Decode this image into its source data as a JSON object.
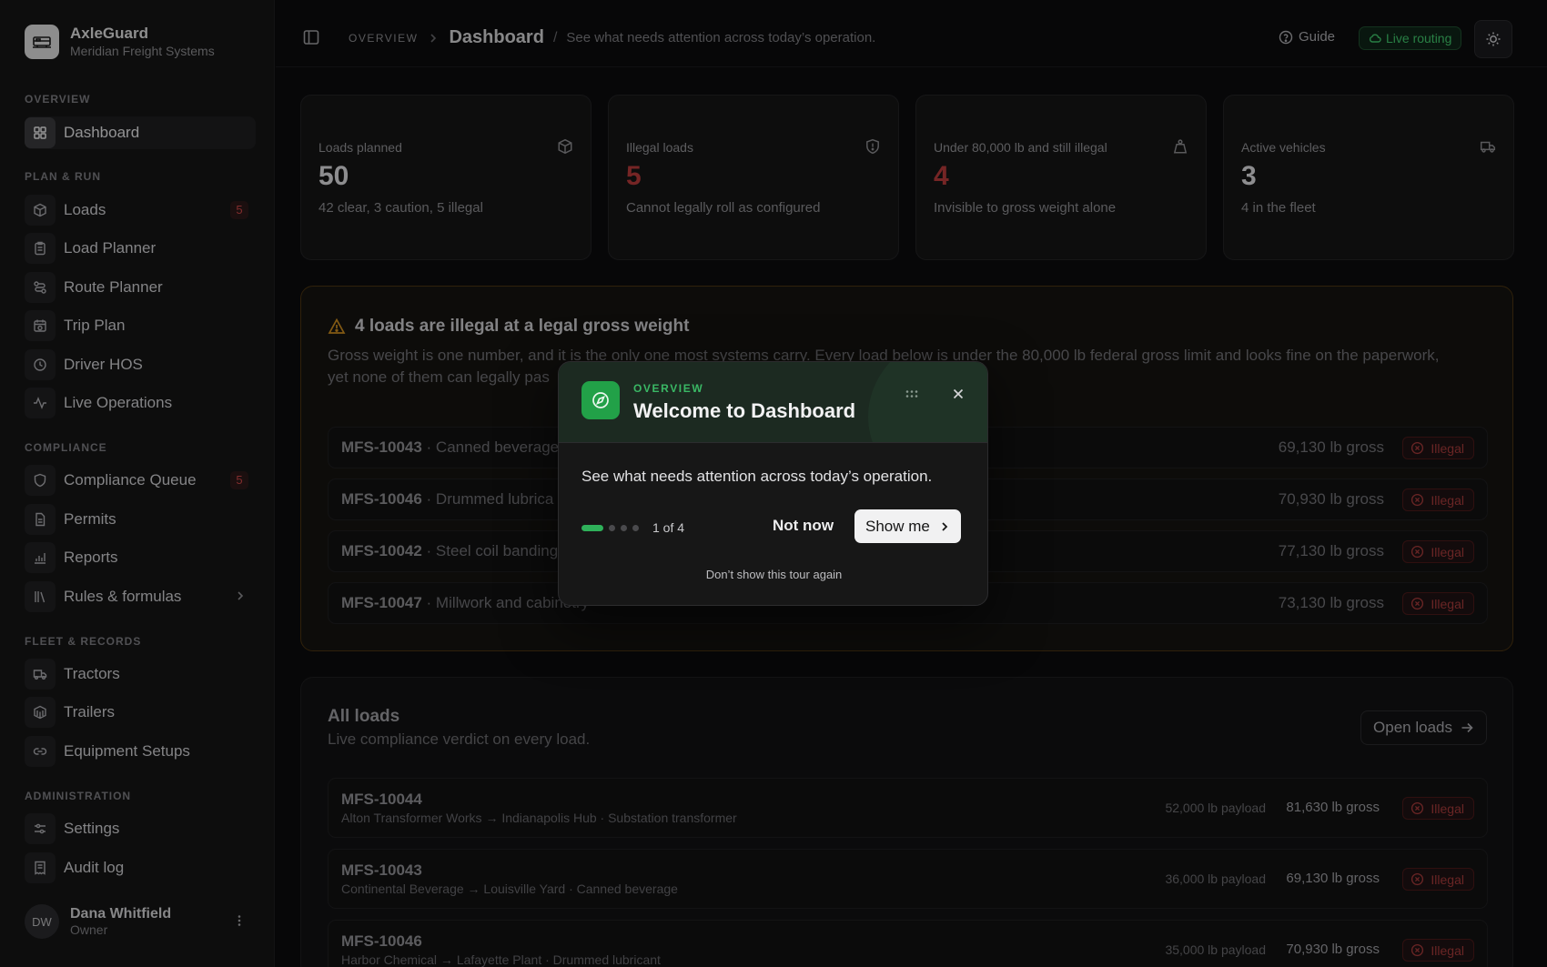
{
  "brand": {
    "name": "AxleGuard",
    "subtitle": "Meridian Freight Systems"
  },
  "sidebar": {
    "sections": {
      "overview": "OVERVIEW",
      "plan_run": "PLAN & RUN",
      "compliance": "COMPLIANCE",
      "fleet": "FLEET & RECORDS",
      "admin": "ADMINISTRATION"
    },
    "items": {
      "dashboard": "Dashboard",
      "loads": "Loads",
      "loads_badge": "5",
      "load_planner": "Load Planner",
      "route_planner": "Route Planner",
      "trip_plan": "Trip Plan",
      "driver_hos": "Driver HOS",
      "live_operations": "Live Operations",
      "compliance_queue": "Compliance Queue",
      "compliance_badge": "5",
      "permits": "Permits",
      "reports": "Reports",
      "rules": "Rules & formulas",
      "tractors": "Tractors",
      "trailers": "Trailers",
      "equipment": "Equipment Setups",
      "settings": "Settings",
      "audit_log": "Audit log"
    },
    "user": {
      "initials": "DW",
      "name": "Dana Whitfield",
      "role": "Owner"
    }
  },
  "topbar": {
    "breadcrumb_root": "OVERVIEW",
    "title": "Dashboard",
    "description": "See what needs attention across today’s operation.",
    "guide": "Guide",
    "live_routing": "Live routing"
  },
  "stats": [
    {
      "label": "Loads planned",
      "value": "50",
      "sub": "42 clear, 3 caution, 5 illegal"
    },
    {
      "label": "Illegal loads",
      "value": "5",
      "sub": "Cannot legally roll as configured"
    },
    {
      "label": "Under 80,000 lb and still illegal",
      "value": "4",
      "sub": "Invisible to gross weight alone"
    },
    {
      "label": "Active vehicles",
      "value": "3",
      "sub": "4 in the fleet"
    }
  ],
  "alert": {
    "title": "4 loads are illegal at a legal gross weight",
    "text_line1": "Gross weight is one number, and it is the only one most systems carry. Every load below is under the 80,000 lb federal gross limit and looks fine on the paperwork,",
    "text_line2": "yet none of them can legally pas",
    "rows": [
      {
        "id": "MFS-10043",
        "desc": " · Canned beverage",
        "gross": "69,130 lb gross",
        "status": "Illegal"
      },
      {
        "id": "MFS-10046",
        "desc": " · Drummed lubrica",
        "gross": "70,930 lb gross",
        "status": "Illegal"
      },
      {
        "id": "MFS-10042",
        "desc": " · Steel coil banding",
        "gross": "77,130 lb gross",
        "status": "Illegal"
      },
      {
        "id": "MFS-10047",
        "desc": " · Millwork and cabinetry",
        "gross": "73,130 lb gross",
        "status": "Illegal"
      }
    ]
  },
  "all_loads": {
    "title": "All loads",
    "subtitle": "Live compliance verdict on every load.",
    "open_button": "Open loads",
    "rows": [
      {
        "id": "MFS-10044",
        "route": "Alton Transformer Works → Indianapolis Hub · Substation transformer",
        "payload": "52,000 lb payload",
        "gross": "81,630 lb gross",
        "status": "Illegal"
      },
      {
        "id": "MFS-10043",
        "route": "Continental Beverage → Louisville Yard · Canned beverage",
        "payload": "36,000 lb payload",
        "gross": "69,130 lb gross",
        "status": "Illegal"
      },
      {
        "id": "MFS-10046",
        "route": "Harbor Chemical → Lafayette Plant · Drummed lubricant",
        "payload": "35,000 lb payload",
        "gross": "70,930 lb gross",
        "status": "Illegal"
      }
    ]
  },
  "tour": {
    "kicker": "OVERVIEW",
    "title": "Welcome to Dashboard",
    "body": "See what needs attention across today’s operation.",
    "step": "1 of 4",
    "step_current": 1,
    "step_total": 4,
    "not_now": "Not now",
    "show_me": "Show me",
    "dont_show": "Don’t show this tour again"
  },
  "colors": {
    "accent_green": "#22a148",
    "illegal_red": "#a33a3a",
    "alert_border": "#4a3411"
  }
}
